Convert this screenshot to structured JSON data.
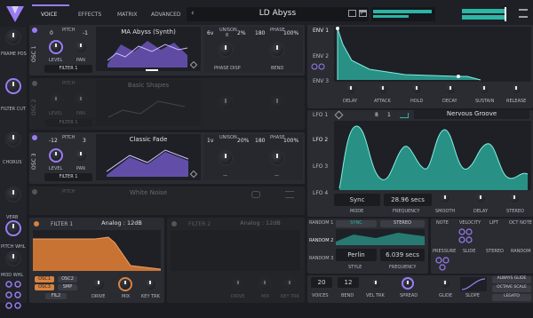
{
  "top_tabs": {
    "voice": "VOICE",
    "effects": "EFFECTS",
    "matrix": "MATRIX",
    "advanced": "ADVANCED"
  },
  "preset": {
    "name": "LD Abyss",
    "prev": "‹",
    "next": "›"
  },
  "left_mod": {
    "frame_pos": "FRAME POS",
    "filter_cut": "FILTER CUT",
    "chorus": "CHORUS",
    "verb": "VERB",
    "pitch_whl": "PITCH WHL",
    "mod_whl": "MOD WHL"
  },
  "osc1": {
    "label": "OSC 1",
    "pitch_oct": "0",
    "pitch_label": "PITCH",
    "pitch_semi": "-1",
    "level": "LEVEL",
    "pan": "PAN",
    "filter_dest": "FILTER 1",
    "wavetable": "MA Abyss (Synth)",
    "unison_voices": "6v",
    "unison_label": "UNISON",
    "unison_mid": "8",
    "unison_detune": "2%",
    "phase_val": "180",
    "phase_label": "PHASE",
    "phase_rand": "100%",
    "phase_disp": "PHASE DISP",
    "bend": "BEND"
  },
  "osc2": {
    "label": "OSC 2",
    "pitch_label": "PITCH",
    "level": "LEVEL",
    "pan": "PAN",
    "filter_dest": "FILTER 1",
    "wavetable": "Basic Shapes"
  },
  "osc3": {
    "label": "OSC 3",
    "pitch_oct": "-12",
    "pitch_label": "PITCH",
    "pitch_semi": "3",
    "level": "LEVEL",
    "pan": "PAN",
    "filter_dest": "FILTER 1",
    "wavetable": "Classic Fade",
    "unison_voices": "1v",
    "unison_label": "UNISON",
    "unison_detune": "20%",
    "phase_val": "180",
    "phase_label": "PHASE",
    "phase_rand": "100%",
    "dash1": "—",
    "dash2": "—"
  },
  "sample": {
    "pitch_label": "PITCH",
    "name": "White Noise"
  },
  "env": {
    "env1": "ENV 1",
    "env2": "ENV 2",
    "env3": "ENV 3",
    "delay": "DELAY",
    "attack": "ATTACK",
    "hold": "HOLD",
    "decay": "DECAY",
    "sustain": "SUSTAIN",
    "release": "RELEASE"
  },
  "lfo": {
    "lfo1": "LFO 1",
    "lfo2": "LFO 2",
    "lfo3": "LFO 3",
    "lfo4": "LFO 4",
    "grid_x": "8",
    "grid_y": "1",
    "shape": "Nervous Groove",
    "mode_val": "Sync",
    "mode": "MODE",
    "freq_val": "28.96 secs",
    "frequency": "FREQUENCY",
    "smooth": "SMOOTH",
    "delay": "DELAY",
    "stereo": "STEREO"
  },
  "filter1": {
    "title": "FILTER 1",
    "model": "Analog : 12dB",
    "osc1": "OSC1",
    "osc2": "OSC2",
    "osc3": "OSC3",
    "smp": "SMP",
    "fil2": "FIL2",
    "drive": "DRIVE",
    "mix": "MIX",
    "key_trk": "KEY TRK"
  },
  "filter2": {
    "title": "FILTER 2",
    "model": "Analog : 12dB",
    "drive": "DRIVE",
    "mix": "MIX",
    "key_trk": "KEY TRK"
  },
  "random": {
    "r1": "RANDOM 1",
    "r2": "RANDOM 2",
    "r3": "RANDOM 3",
    "sync": "SYNC",
    "stereo": "STEREO",
    "style_val": "Perlin",
    "style": "STYLE",
    "freq_val": "6.039 secs",
    "frequency": "FREQUENCY"
  },
  "mods": {
    "note": "NOTE",
    "velocity": "VELOCITY",
    "lift": "LIFT",
    "oct_note": "OCT NOTE",
    "pressure": "PRESSURE",
    "slide": "SLIDE",
    "stereo": "STEREO",
    "random": "RANDOM"
  },
  "voice": {
    "voices_val": "20",
    "voices": "VOICES",
    "bend_val": "12",
    "bend": "BEND",
    "vel_trk": "VEL TRK",
    "spread": "SPREAD",
    "glide": "GLIDE",
    "slope": "SLOPE",
    "always_glide": "ALWAYS GLIDE",
    "octave_scale": "OCTAVE SCALE",
    "legato": "LEGATO"
  },
  "colors": {
    "accent": "#9b7cf2",
    "teal": "#2db5a5",
    "orange": "#d9823f",
    "bg": "#1b1d22",
    "panel": "#2a2c32"
  }
}
